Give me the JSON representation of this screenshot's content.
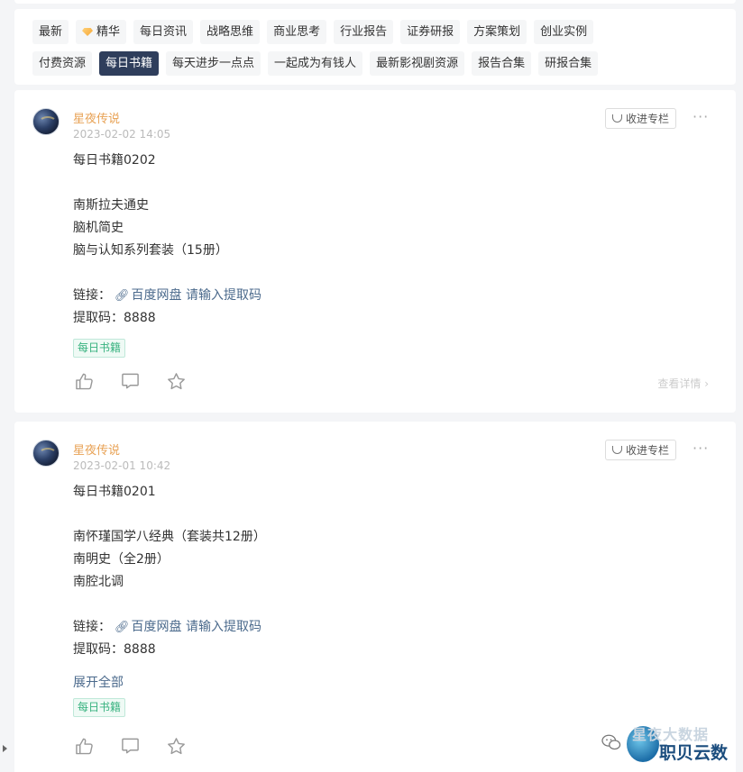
{
  "tags": {
    "row1": [
      "最新",
      "精华",
      "每日资讯",
      "战略思维",
      "商业思考",
      "行业报告",
      "证券研报",
      "方案策划",
      "创业实例"
    ],
    "row2": [
      "付费资源",
      "每日书籍",
      "每天进步一点点",
      "一起成为有钱人",
      "最新影视剧资源",
      "报告合集",
      "研报合集"
    ],
    "active": "每日书籍",
    "active_bg": "#2f3e5c"
  },
  "posts": [
    {
      "author": "星夜传说",
      "time": "2023-02-02 14:05",
      "collect_label": "收进专栏",
      "more": "···",
      "title": "每日书籍0202",
      "books": [
        "南斯拉夫通史",
        "脑机简史",
        "脑与认知系列套装（15册）"
      ],
      "link_label": "链接：",
      "link_text": "百度网盘 请输入提取码",
      "code": "提取码：8888",
      "tag": "每日书籍",
      "detail": "查看详情"
    },
    {
      "author": "星夜传说",
      "time": "2023-02-01 10:42",
      "collect_label": "收进专栏",
      "more": "···",
      "title": "每日书籍0201",
      "books": [
        "南怀瑾国学八经典（套装共12册）",
        "南明史（全2册）",
        "南腔北调"
      ],
      "link_label": "链接：",
      "link_text": "百度网盘 请输入提取码",
      "code": "提取码：8888",
      "expand": "展开全部",
      "tag": "每日书籍"
    }
  ],
  "watermark": {
    "top_text": "星夜大数据",
    "name": "职贝云数"
  },
  "colors": {
    "author": "#e8a255",
    "link": "#4b6a8c",
    "tag_green": "#37b27f"
  }
}
